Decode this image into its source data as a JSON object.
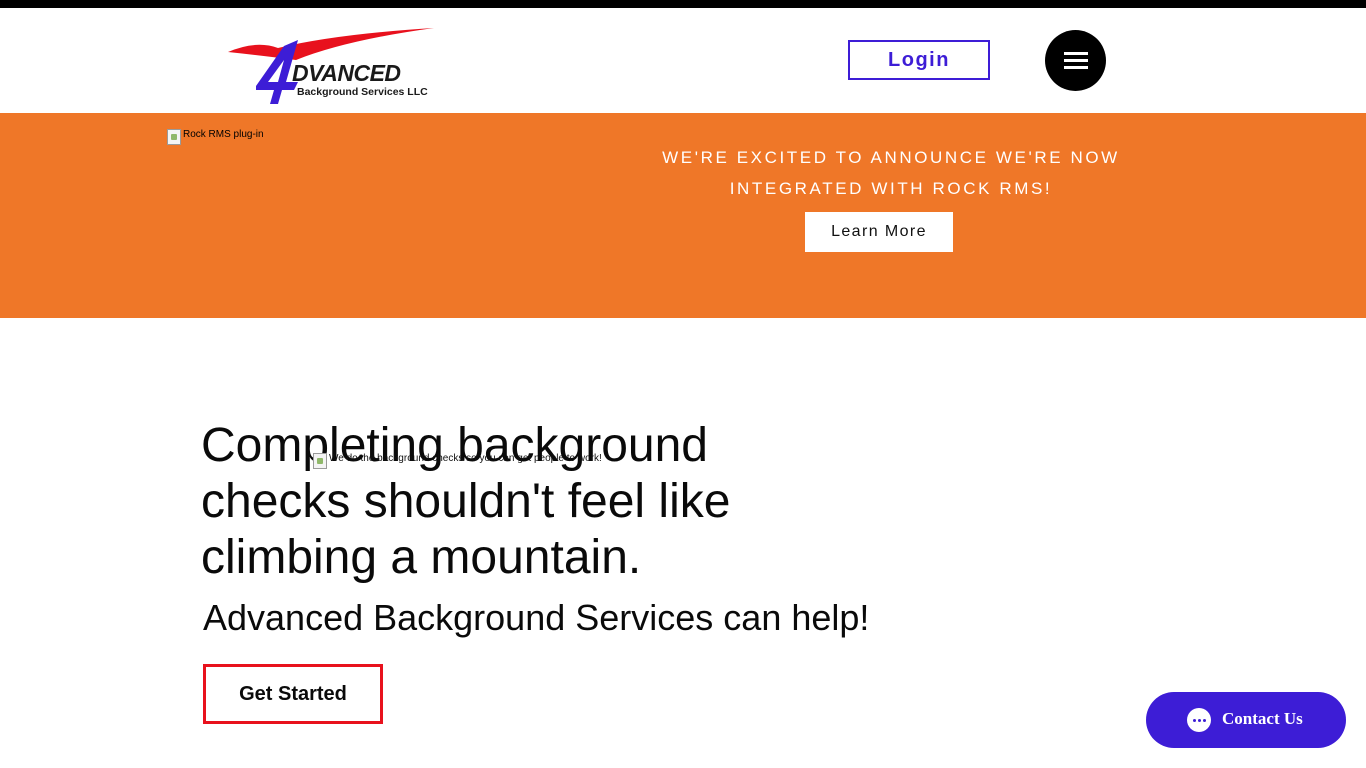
{
  "header": {
    "logo": {
      "wordmark": "DVANCED",
      "subtitle": "Background Services LLC"
    },
    "login_label": "Login",
    "menu_icon": "hamburger-icon"
  },
  "banner": {
    "image_alt": "Rock RMS plug-in",
    "announcement_line1": "WE'RE EXCITED TO ANNOUNCE WE'RE NOW",
    "announcement_line2": "INTEGRATED WITH ROCK RMS!",
    "learn_more_label": "Learn More"
  },
  "hero": {
    "heading_line1": "Completing background",
    "heading_line2": "checks shouldn't feel like",
    "heading_line3": "climbing a mountain.",
    "image_alt": "We do the background checks so you can get people to work!",
    "subheading": "Advanced Background Services can help!",
    "cta_label": "Get Started"
  },
  "chat_widget": {
    "label": "Contact Us",
    "icon": "chat-bubble-icon"
  },
  "colors": {
    "brand_purple": "#3d1dd6",
    "banner_orange": "#ef7728",
    "cta_red": "#e8111d",
    "logo_red": "#e8111d"
  }
}
